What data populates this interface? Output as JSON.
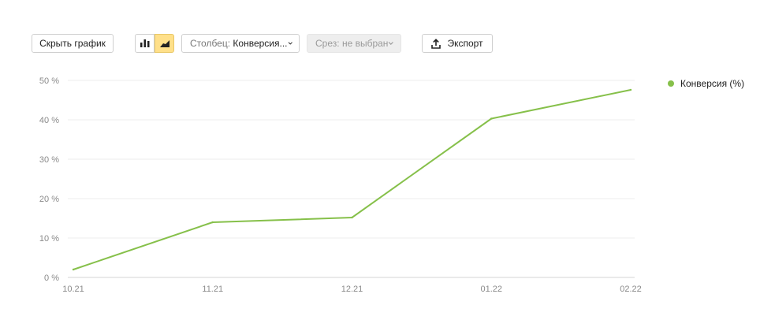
{
  "toolbar": {
    "hide_chart_label": "Скрыть график",
    "bar_mode_icon": "bar-chart-icon",
    "area_mode_icon": "area-chart-icon",
    "column_label_prefix": "Столбец:",
    "column_value": "Конверсия...",
    "slice_label_prefix": "Срез:",
    "slice_value": "не выбран",
    "export_label": "Экспорт",
    "export_icon": "upload-icon",
    "active_mode_color": "#ffe08a"
  },
  "chart_data": {
    "type": "line",
    "categories": [
      "10.21",
      "11.21",
      "12.21",
      "01.22",
      "02.22"
    ],
    "series": [
      {
        "name": "Конверсия (%)",
        "values": [
          2,
          14,
          15.2,
          40.3,
          47.6
        ],
        "color": "#86c04a"
      }
    ],
    "ylim": [
      0,
      50
    ],
    "yticks": [
      "0 %",
      "10 %",
      "20 %",
      "30 %",
      "40 %",
      "50 %"
    ],
    "grid": true,
    "legend_position": "right"
  }
}
